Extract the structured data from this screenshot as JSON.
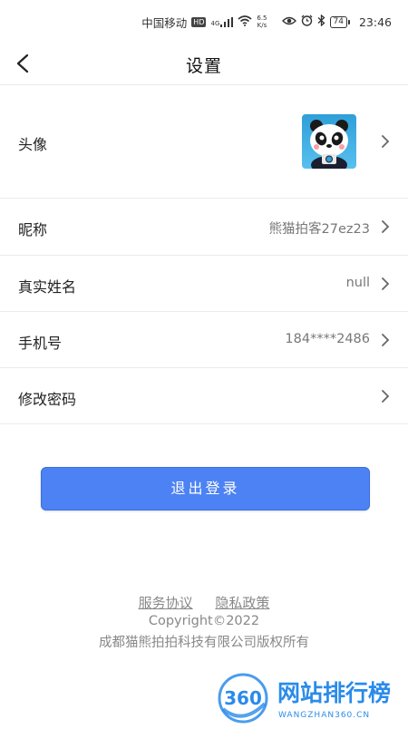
{
  "status_bar": {
    "carrier": "中国移动",
    "hd": "HD",
    "net_type": "4G",
    "speed_value": "6.5",
    "speed_unit": "K/s",
    "battery": "74",
    "time": "23:46"
  },
  "header": {
    "title": "设置"
  },
  "rows": {
    "avatar": {
      "label": "头像"
    },
    "nickname": {
      "label": "昵称",
      "value": "熊猫拍客27ez23"
    },
    "real_name": {
      "label": "真实姓名",
      "value": "null"
    },
    "phone": {
      "label": "手机号",
      "value": "184****2486"
    },
    "password": {
      "label": "修改密码"
    }
  },
  "logout_label": "退出登录",
  "footer": {
    "service_agreement": "服务协议",
    "privacy_policy": "隐私政策",
    "copyright": "Copyright©2022",
    "company": "成都猫熊拍拍科技有限公司版权所有"
  },
  "watermark": {
    "number": "360",
    "title": "网站排行榜",
    "domain": "WANGZHAN360.CN"
  },
  "colors": {
    "primary_button": "#4c82f3",
    "avatar_bg": "#3aa9e0",
    "watermark_blue": "#2a8bea"
  },
  "icons": [
    "back-arrow-icon",
    "chevron-right-icon",
    "wifi-icon",
    "signal-icon",
    "bluetooth-icon",
    "alarm-icon",
    "eye-icon",
    "battery-icon"
  ]
}
